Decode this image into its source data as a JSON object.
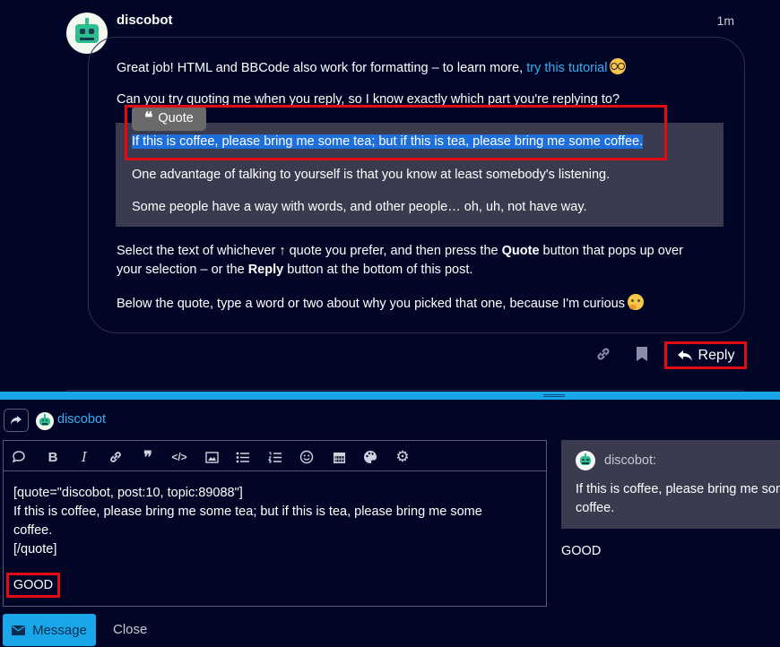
{
  "post": {
    "username": "discobot",
    "age": "1m",
    "intro_text": "Great job! HTML and BBCode also work for formatting – to learn more, ",
    "intro_link": "try this tutorial",
    "ask_text": "Can you try quoting me when you reply, so I know exactly which part you're replying to?",
    "quote_button": "Quote",
    "quotes": [
      "If this is coffee, please bring me some tea; but if this is tea, please bring me some coffee.",
      "One advantage of talking to yourself is that you know at least somebody's listening.",
      "Some people have a way with words, and other people… oh, uh, not have way."
    ],
    "instr_1a": "Select the text of whichever ↑ quote you prefer, and then press the ",
    "instr_1b": "Quote",
    "instr_1c": " button that pops up over",
    "instr_2a": "your selection – or the ",
    "instr_2b": "Reply",
    "instr_2c": " button at the bottom of this post.",
    "instr_3": "Below the quote, type a word or two about why you picked that one, because I'm curious",
    "reply_label": "Reply"
  },
  "composer": {
    "reply_to": "discobot",
    "editor_lines": [
      "[quote=\"discobot, post:10, topic:89088\"]",
      "If this is coffee, please bring me some tea; but if this is tea, please bring me some",
      "coffee.",
      "[/quote]"
    ],
    "editor_answer": "GOOD",
    "preview_user": "discobot:",
    "preview_line1": "If this is coffee, please bring me some tea; but if this is tea, please bring me some coffee.",
    "preview_line2": "coffee.",
    "preview_answer": "GOOD",
    "submit_label": "Message",
    "close_label": "Close"
  },
  "colors": {
    "background": "#020626",
    "accent": "#1aa7ea",
    "highlight": "#e20b14",
    "selection": "#1e6fd9",
    "quote_bg": "#3b3b4f"
  },
  "icons": [
    "robot-avatar-icon",
    "quote-icon",
    "link-icon",
    "bookmark-icon",
    "reply-arrow-icon",
    "share-arrow-icon",
    "chat-bubble-icon",
    "bold-icon",
    "italic-icon",
    "hyperlink-icon",
    "blockquote-icon",
    "code-icon",
    "image-icon",
    "bullet-list-icon",
    "numbered-list-icon",
    "emoji-icon",
    "calendar-icon",
    "palette-icon",
    "gear-icon",
    "envelope-icon"
  ]
}
